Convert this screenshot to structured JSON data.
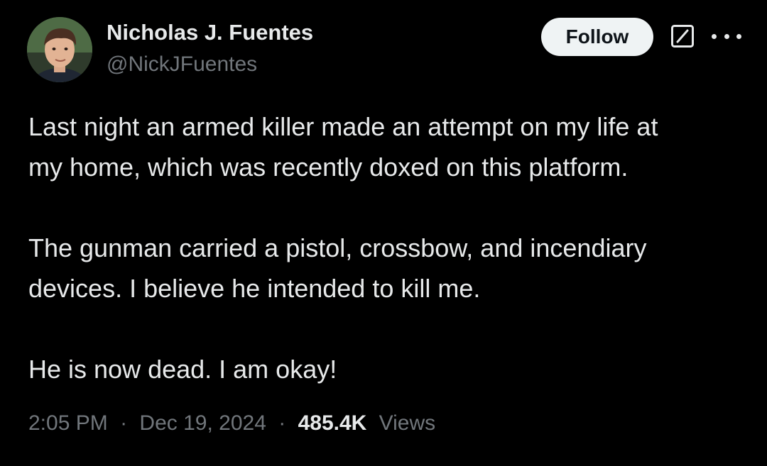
{
  "author": {
    "display_name": "Nicholas J. Fuentes",
    "handle": "@NickJFuentes"
  },
  "actions": {
    "follow_label": "Follow",
    "grok_icon": "grok-icon",
    "more_icon": "more-options-icon"
  },
  "tweet": {
    "paragraphs": [
      "Last night an armed killer made an attempt on my life at\nmy home, which was recently doxed on this platform.",
      "The gunman carried a pistol, crossbow, and incendiary\ndevices. I believe he intended to kill me.",
      "He is now dead. I am okay!"
    ]
  },
  "meta": {
    "time": "2:05 PM",
    "separator": "·",
    "date": "Dec 19, 2024",
    "views_count": "485.4K",
    "views_label": "Views"
  },
  "colors": {
    "background": "#000000",
    "primary_text": "#e7e9ea",
    "secondary_text": "#71767b",
    "follow_button_bg": "#eff3f4"
  }
}
